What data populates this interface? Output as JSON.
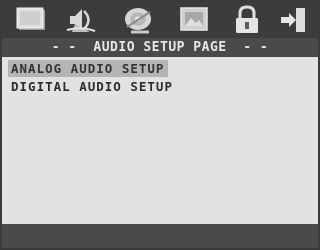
{
  "toolbar": {
    "icons": [
      {
        "name": "general-setup-icon"
      },
      {
        "name": "audio-setup-icon"
      },
      {
        "name": "video-setup-icon"
      },
      {
        "name": "preference-icon"
      },
      {
        "name": "password-lock-icon"
      },
      {
        "name": "exit-icon"
      }
    ]
  },
  "page": {
    "title": "- -  AUDIO SETUP PAGE  - -"
  },
  "menu": {
    "items": [
      {
        "label": "ANALOG AUDIO SETUP",
        "selected": true
      },
      {
        "label": "DIGITAL AUDIO SETUP",
        "selected": false
      }
    ]
  },
  "colors": {
    "bar_background": "#3a3a3a",
    "content_background": "#e2e2e2",
    "highlight": "#b4b4b4",
    "icon_color": "#dcdcdc"
  }
}
